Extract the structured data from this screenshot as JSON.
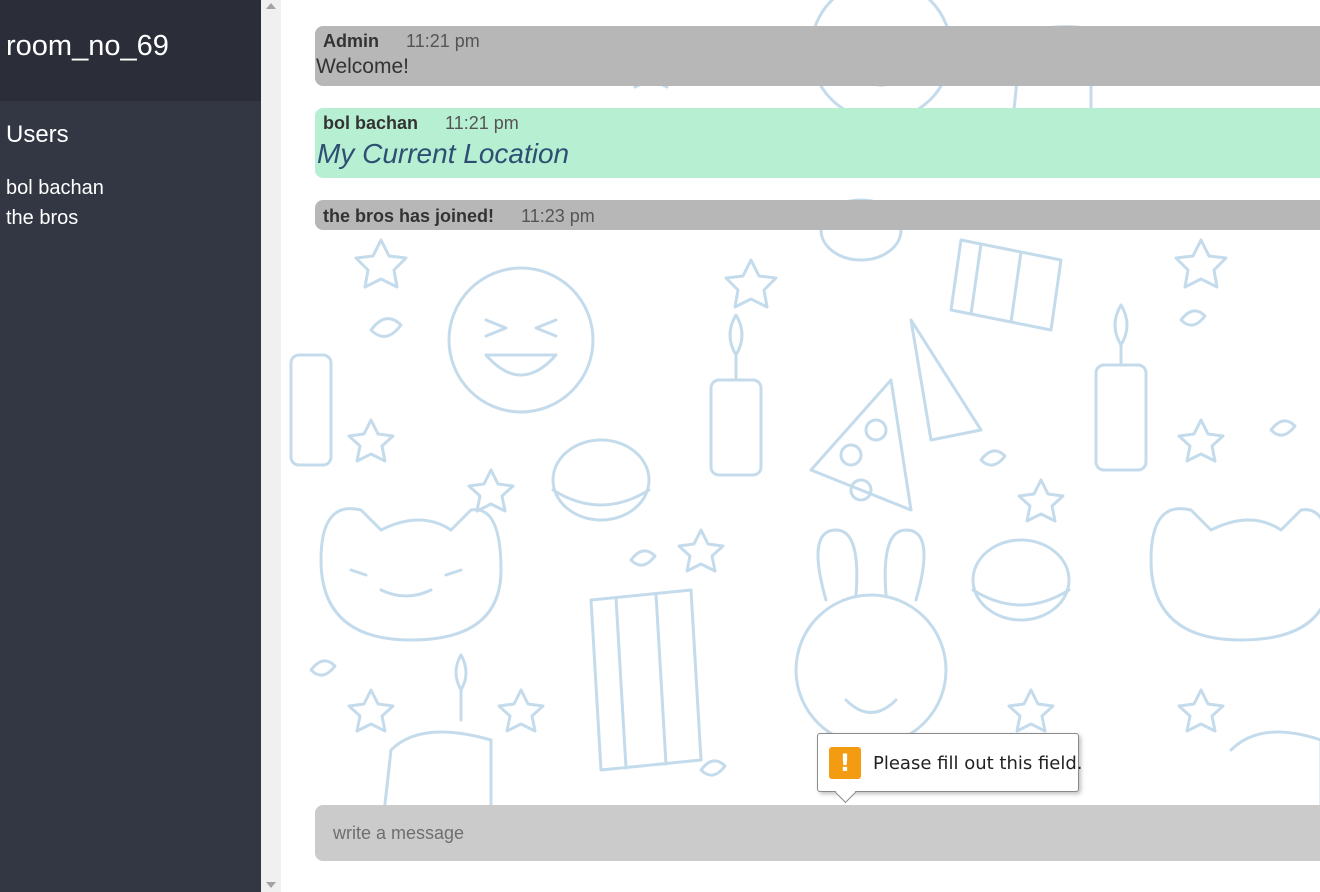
{
  "sidebar": {
    "room_name": "room_no_69",
    "users_heading": "Users",
    "users": [
      "bol bachan",
      "the bros"
    ]
  },
  "messages": [
    {
      "author": "Admin",
      "time": "11:21 pm",
      "text": "Welcome!",
      "style": "gray"
    },
    {
      "author": "bol bachan",
      "time": "11:21 pm",
      "link_text": "My Current Location",
      "style": "green"
    },
    {
      "author": "the bros has joined!",
      "time": "11:23 pm",
      "style": "gray"
    }
  ],
  "composer": {
    "placeholder": "write a message",
    "value": ""
  },
  "validation_tooltip": {
    "icon": "warning-icon",
    "text": "Please fill out this field."
  },
  "colors": {
    "sidebar_bg": "#333744",
    "header_bg": "#2b2e39",
    "message_gray": "#b7b7b7",
    "message_green": "#b7efd3",
    "link": "#2e4f73",
    "warning": "#f39c12",
    "doodle": "#c4dbec"
  }
}
